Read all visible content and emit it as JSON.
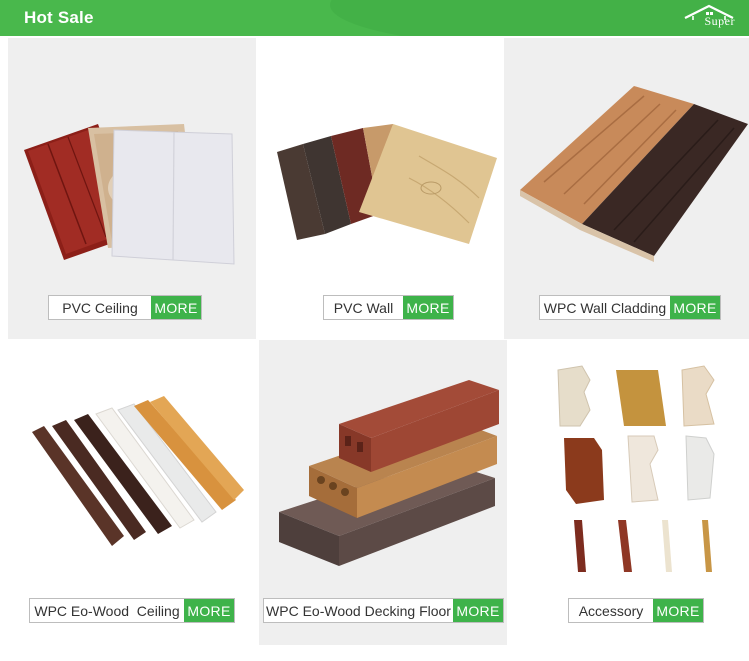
{
  "header": {
    "title": "Hot Sale",
    "logo_text": "Super",
    "logo_icon": "house-roof-icon"
  },
  "colors": {
    "header_green": "#49b84c",
    "more_green": "#3eb34a",
    "tile_gray": "#efefef"
  },
  "products": [
    {
      "id": "pvc-ceiling",
      "name": "PVC Ceiling",
      "more": "MORE"
    },
    {
      "id": "pvc-wall",
      "name": "PVC Wall",
      "more": "MORE"
    },
    {
      "id": "wpc-wall-cladding",
      "name": "WPC Wall Cladding",
      "more": "MORE"
    },
    {
      "id": "wpc-eo-wood-ceiling",
      "name": "WPC Eo-Wood  Ceiling",
      "more": "MORE"
    },
    {
      "id": "wpc-eo-wood-decking-floor",
      "name": "WPC Eo-Wood Decking Floor",
      "more": "MORE"
    },
    {
      "id": "accessory",
      "name": "Accessory",
      "more": "MORE"
    }
  ]
}
